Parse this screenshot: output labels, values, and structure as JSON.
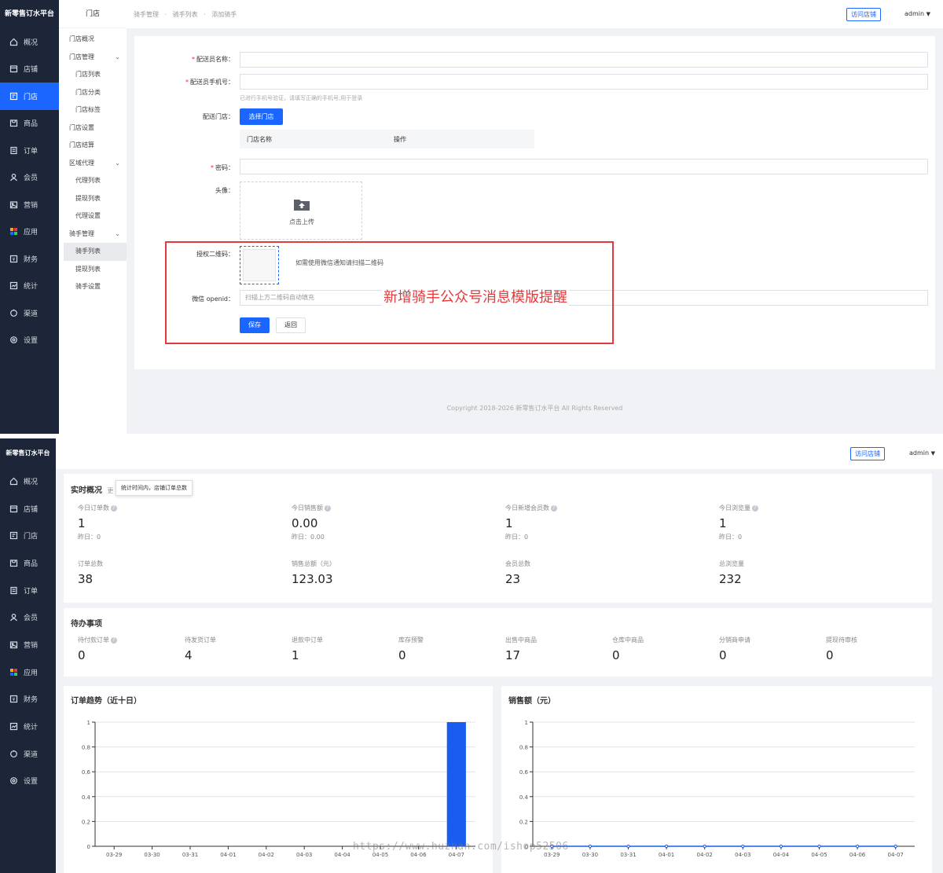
{
  "top": {
    "brand": "新零售订水平台",
    "nav": [
      {
        "label": "概况",
        "icon": "home-icon"
      },
      {
        "label": "店铺",
        "icon": "shop-icon"
      },
      {
        "label": "门店",
        "icon": "store-icon"
      },
      {
        "label": "商品",
        "icon": "goods-icon"
      },
      {
        "label": "订单",
        "icon": "order-icon"
      },
      {
        "label": "会员",
        "icon": "member-icon"
      },
      {
        "label": "营销",
        "icon": "marketing-icon"
      },
      {
        "label": "应用",
        "icon": "apps-icon"
      },
      {
        "label": "财务",
        "icon": "finance-icon"
      },
      {
        "label": "统计",
        "icon": "stats-icon"
      },
      {
        "label": "渠道",
        "icon": "channel-icon"
      },
      {
        "label": "设置",
        "icon": "settings-icon"
      }
    ],
    "active_nav": "门店",
    "subnav": {
      "title": "门店",
      "items": [
        {
          "label": "门店概况",
          "child": false
        },
        {
          "label": "门店管理",
          "child": false,
          "expand": true
        },
        {
          "label": "门店列表",
          "child": true
        },
        {
          "label": "门店分类",
          "child": true
        },
        {
          "label": "门店标签",
          "child": true
        },
        {
          "label": "门店设置",
          "child": false
        },
        {
          "label": "门店结算",
          "child": false
        },
        {
          "label": "区域代理",
          "child": false,
          "expand": true
        },
        {
          "label": "代理列表",
          "child": true
        },
        {
          "label": "提现列表",
          "child": true
        },
        {
          "label": "代理设置",
          "child": true
        },
        {
          "label": "骑手管理",
          "child": false,
          "expand": true
        },
        {
          "label": "骑手列表",
          "child": true,
          "active": true
        },
        {
          "label": "提现列表",
          "child": true
        },
        {
          "label": "骑手设置",
          "child": true
        }
      ]
    },
    "breadcrumb": [
      "骑手管理",
      "骑手列表",
      "添加骑手"
    ],
    "breadcrumb_sep": "·",
    "visit_store": "访问店铺",
    "admin": "admin",
    "form": {
      "name_label": "配送员名称：",
      "phone_label": "配送员手机号：",
      "phone_hint": "已进行手机号验证，请填写正确的手机号,用于登录",
      "store_label": "配送门店：",
      "select_store": "选择门店",
      "table_headers": [
        "门店名称",
        "操作"
      ],
      "password_label": "密码：",
      "avatar_label": "头像：",
      "upload_text": "点击上传",
      "qr_label": "授权二维码：",
      "qr_hint": "如需使用微信通知请扫描二维码",
      "openid_label": "微信 openid：",
      "openid_placeholder": "扫描上方二维码自动填充",
      "save": "保存",
      "back": "返回"
    },
    "annotation": "新增骑手公众号消息模版提醒",
    "copyright": "Copyright 2018-2026 新零售订水平台 All Rights Reserved",
    "colors": {
      "accent": "#1a66ff",
      "sidebar": "#1c2638",
      "annotation": "#e5393c"
    }
  },
  "bottom": {
    "brand": "新零售订水平台",
    "visit_store": "访问店铺",
    "admin": "admin",
    "realtime": {
      "title": "实时概况",
      "title_suffix": "更",
      "tooltip": "统计时间内，店铺订单总数",
      "stats": [
        {
          "label": "今日订单数",
          "value": "1",
          "sub": "昨日：0"
        },
        {
          "label": "今日销售额",
          "value": "0.00",
          "sub": "昨日：0.00"
        },
        {
          "label": "今日新增会员数",
          "value": "1",
          "sub": "昨日：0"
        },
        {
          "label": "今日浏览量",
          "value": "1",
          "sub": "昨日：0"
        }
      ],
      "totals": [
        {
          "label": "订单总数",
          "value": "38"
        },
        {
          "label": "销售总额（元）",
          "value": "123.03"
        },
        {
          "label": "会员总数",
          "value": "23"
        },
        {
          "label": "总浏览量",
          "value": "232"
        }
      ]
    },
    "todo": {
      "title": "待办事项",
      "items": [
        {
          "label": "待付款订单",
          "value": "0",
          "q": true
        },
        {
          "label": "待发货订单",
          "value": "4"
        },
        {
          "label": "退款中订单",
          "value": "1"
        },
        {
          "label": "库存预警",
          "value": "0"
        },
        {
          "label": "出售中商品",
          "value": "17"
        },
        {
          "label": "仓库中商品",
          "value": "0"
        },
        {
          "label": "分销商申请",
          "value": "0"
        },
        {
          "label": "提现待审核",
          "value": "0"
        }
      ]
    },
    "watermark": "https://www.huzhan.com/ishop52506"
  },
  "chart_data": [
    {
      "type": "bar",
      "title": "订单趋势（近十日）",
      "categories": [
        "03-29",
        "03-30",
        "03-31",
        "04-01",
        "04-02",
        "04-03",
        "04-04",
        "04-05",
        "04-06",
        "04-07"
      ],
      "values": [
        0,
        0,
        0,
        0,
        0,
        0,
        0,
        0,
        0,
        1
      ],
      "ylim": [
        0,
        1
      ],
      "yticks": [
        "0",
        "0.2",
        "0.4",
        "0.6",
        "0.8",
        "1"
      ],
      "color": "#1a5cf0",
      "grid": true
    },
    {
      "type": "line",
      "title": "销售额（元）",
      "categories": [
        "03-29",
        "03-30",
        "03-31",
        "04-01",
        "04-02",
        "04-03",
        "04-04",
        "04-05",
        "04-06",
        "04-07"
      ],
      "values": [
        0,
        0,
        0,
        0,
        0,
        0,
        0,
        0,
        0,
        0
      ],
      "ylim": [
        0,
        1
      ],
      "yticks": [
        "0",
        "0.2",
        "0.4",
        "0.6",
        "0.8",
        "1"
      ],
      "color": "#1a5cf0",
      "grid": true
    }
  ]
}
